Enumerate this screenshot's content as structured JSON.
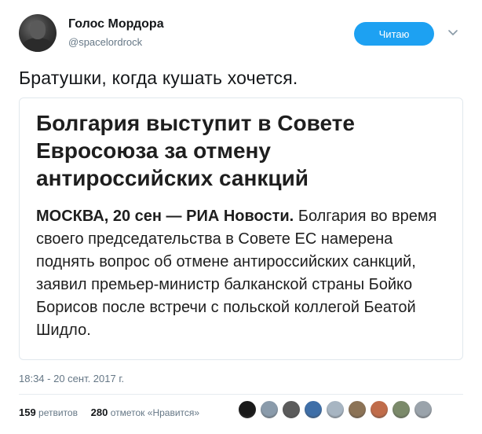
{
  "user": {
    "display_name": "Голос Мордора",
    "handle": "@spacelordrock",
    "avatar_icon": "avatar-photo"
  },
  "follow_button": {
    "label": "Читаю"
  },
  "caret_icon": "chevron-down-icon",
  "tweet": {
    "text": "Братушки, когда кушать хочется."
  },
  "card": {
    "headline": "Болгария выступит в Совете Евросоюза за отмену антироссийских санкций",
    "lead": "МОСКВА, 20 сен — РИА Новости.",
    "body": "Болгария во время своего председательства в Совете ЕС намерена поднять вопрос об отмене антироссийских санкций, заявил премьер-министр балканской страны Бойко Борисов после встречи с польской коллегой Беатой Шидло."
  },
  "timestamp": "18:34 - 20 сент. 2017 г.",
  "stats": {
    "retweets_count": "159",
    "retweets_label": "ретвитов",
    "likes_count": "280",
    "likes_label": "отметок «Нравится»"
  },
  "liker_avatars": [
    {
      "color": "#1a1a1a"
    },
    {
      "color": "#8a9bab"
    },
    {
      "color": "#5b5b5b"
    },
    {
      "color": "#3f6fa8"
    },
    {
      "color": "#a7b5c2"
    },
    {
      "color": "#8c7356"
    },
    {
      "color": "#c06c4a"
    },
    {
      "color": "#7b8a6a"
    },
    {
      "color": "#9aa3ab"
    }
  ]
}
